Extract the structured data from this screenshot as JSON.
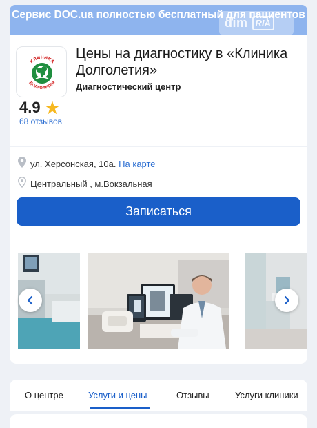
{
  "banner": {
    "text": "Сервис DOC.ua полностью бесплатный для пациентов"
  },
  "watermark": {
    "left": "dim",
    "right": "RIA"
  },
  "clinic": {
    "logo_text_top": "КЛИНИКА",
    "logo_text_bottom": "ДОЛГОЛЕТИЯ",
    "title": "Цены на диагностику в «Клиника Долголетия»",
    "subtitle": "Диагностический центр",
    "rating": "4.9",
    "reviews": "68 отзывов"
  },
  "location": {
    "address": "ул. Херсонская, 10а.",
    "map_link": "На карте",
    "metro": "Центральный , м.Вокзальная"
  },
  "booking": {
    "button_label": "Записаться"
  },
  "gallery": {
    "prev_icon": "chevron-left-icon",
    "next_icon": "chevron-right-icon"
  },
  "tabs": [
    {
      "label": "О центре"
    },
    {
      "label": "Услуги и цены",
      "active": true
    },
    {
      "label": "Отзывы"
    },
    {
      "label": "Услуги клиники"
    }
  ],
  "colors": {
    "accent": "#1a5fc9",
    "banner": "#8eb4ee",
    "star": "#f6b820",
    "logo_green": "#1f8e3f",
    "logo_red": "#d52b2b"
  }
}
